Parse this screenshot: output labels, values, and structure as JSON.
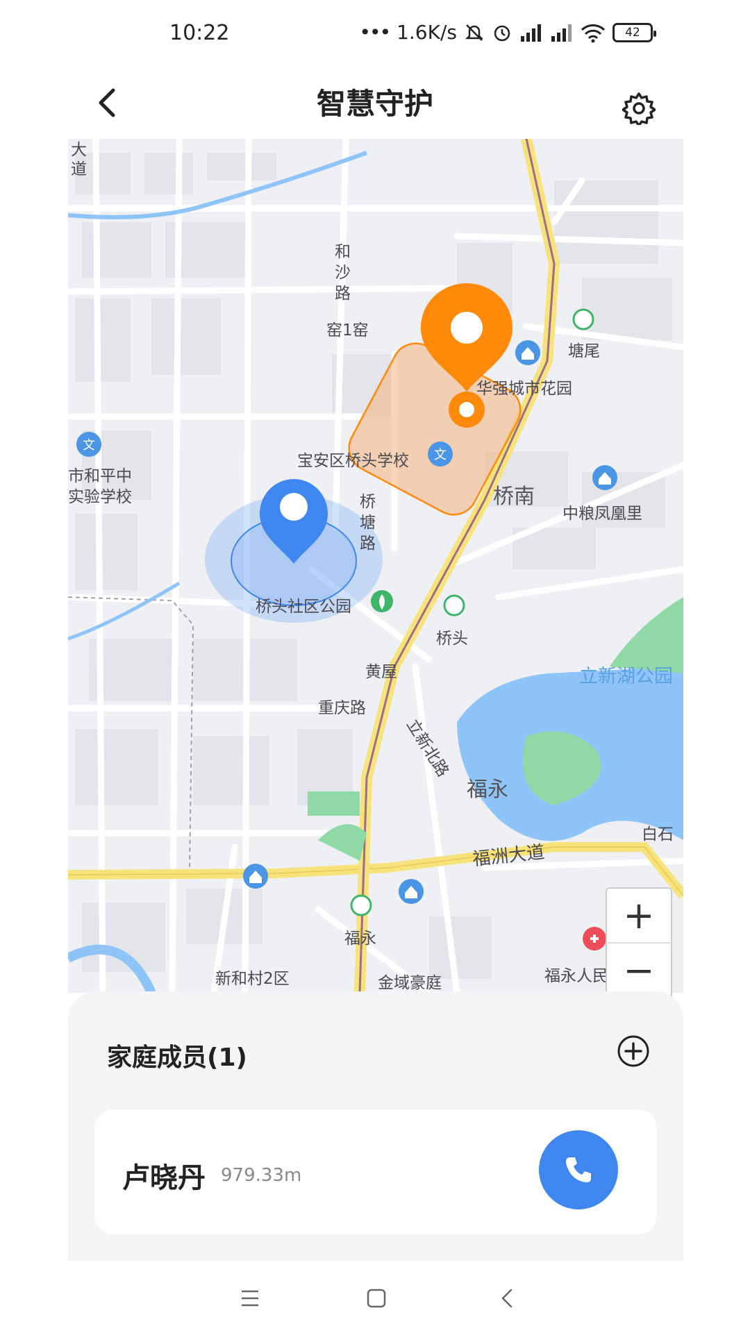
{
  "status_bar": {
    "time": "10:22",
    "net_speed": "1.6K/s",
    "battery": "42",
    "icons": [
      "more-dots-icon",
      "mute-icon",
      "alarm-icon",
      "hd-signal-icon",
      "signal-icon",
      "wifi-icon",
      "battery-icon"
    ]
  },
  "header": {
    "title": "智慧守护",
    "back_icon": "chevron-left-icon",
    "settings_icon": "gear-icon"
  },
  "map": {
    "labels": {
      "dadao": "大\n道",
      "hesha": "和\n沙\n路",
      "yao1yao": "窑1窑",
      "tangwei": "塘尾",
      "huaqiang": "华强城市花园",
      "school1a": "市和平中",
      "school1b": "实验学校",
      "qiaotou_school": "宝安区桥头学校",
      "qiaonan": "桥南",
      "zhongliang": "中粮凤凰里",
      "qiaotang": "桥\n塘\n路",
      "park": "桥头社区公园",
      "qiaotou": "桥头",
      "huangwu": "黄屋",
      "lixin_park": "立新湖公园",
      "chongqing": "重庆路",
      "lixin_north": "立新北路",
      "fuyong_area": "福永",
      "baishi": "白石",
      "fuzhou": "福洲大道",
      "fuyong_station": "福永",
      "xinhe": "新和村2区",
      "jinyu": "金域豪庭",
      "hospital": "福永人民医院"
    },
    "zoom": {
      "in": "+",
      "out": "−"
    },
    "colors": {
      "self_marker": "#3f86ef",
      "member_marker": "#ff8a0a",
      "geofence": "#f6b27c",
      "water": "#8fc4f8",
      "green": "#8ed9a5",
      "major_road": "#f8e27a"
    }
  },
  "members": {
    "title": "家庭成员(1)",
    "add_icon": "plus-circle-icon",
    "list": [
      {
        "name": "卢晓丹",
        "distance": "979.33m",
        "call_icon": "phone-icon"
      }
    ]
  },
  "nav_bar": {
    "icons": [
      "menu-icon",
      "home-square-icon",
      "back-triangle-icon"
    ]
  }
}
